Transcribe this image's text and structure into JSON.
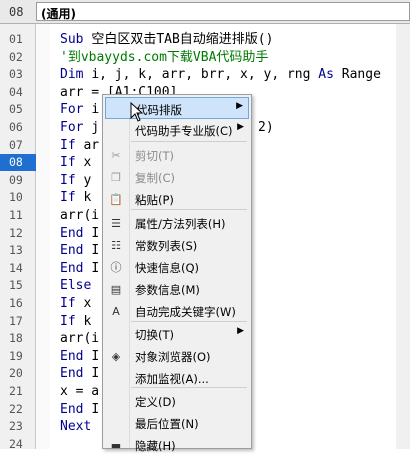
{
  "header": {
    "line_number": "08",
    "object_combo": "(通用)"
  },
  "line_numbers": [
    "01",
    "02",
    "03",
    "04",
    "05",
    "06",
    "07",
    "08",
    "09",
    "10",
    "11",
    "12",
    "13",
    "14",
    "15",
    "16",
    "17",
    "18",
    "19",
    "20",
    "21",
    "22",
    "23",
    "24"
  ],
  "selected_line": "08",
  "code_lines": [
    {
      "kw": "Sub ",
      "rest": "空白区双击TAB自动缩进排版()"
    },
    {
      "cm": "'到vbayyds.com下载VBA代码助手"
    },
    {
      "kw": "Dim ",
      "rest": "i, j, k, arr, brr, x, y, rng ",
      "kw2": "As ",
      "rest2": "Range"
    },
    {
      "rest": "arr = [A1:C100]"
    },
    {
      "kw": "For ",
      "rest": "i"
    },
    {
      "kw": "For ",
      "rest": "j",
      "tail": "2)"
    },
    {
      "kw": "If ",
      "rest": "ar"
    },
    {
      "kw": "If ",
      "rest": "x"
    },
    {
      "kw": "If ",
      "rest": "y"
    },
    {
      "kw": "If ",
      "rest": "k"
    },
    {
      "rest": "arr(i"
    },
    {
      "kw": "End ",
      "rest": "I"
    },
    {
      "kw": "End ",
      "rest": "I"
    },
    {
      "kw": "End ",
      "rest": "I"
    },
    {
      "kw": "Else"
    },
    {
      "kw": "If ",
      "rest": "x"
    },
    {
      "kw": "If ",
      "rest": "k"
    },
    {
      "rest": "arr(i"
    },
    {
      "kw": "End ",
      "rest": "I"
    },
    {
      "kw": "End ",
      "rest": "I"
    },
    {
      "rest": "x = a"
    },
    {
      "kw": "End ",
      "rest": "I"
    },
    {
      "kw": "Next"
    }
  ],
  "context_menu": {
    "items": [
      {
        "label": "代码排版",
        "icon": "none",
        "submenu": true,
        "highlighted": true,
        "disabled": false
      },
      {
        "label": "代码助手专业版(C)",
        "icon": "none",
        "submenu": true,
        "disabled": false
      },
      {
        "label": "剪切(T)",
        "icon": "scissors-icon",
        "disabled": true
      },
      {
        "label": "复制(C)",
        "icon": "copy-icon",
        "disabled": true
      },
      {
        "label": "粘贴(P)",
        "icon": "paste-icon",
        "disabled": false
      },
      {
        "label": "属性/方法列表(H)",
        "icon": "list-icon",
        "disabled": false
      },
      {
        "label": "常数列表(S)",
        "icon": "constant-list-icon",
        "disabled": false
      },
      {
        "label": "快速信息(Q)",
        "icon": "quick-info-icon",
        "disabled": false
      },
      {
        "label": "参数信息(M)",
        "icon": "parameter-info-icon",
        "disabled": false
      },
      {
        "label": "自动完成关键字(W)",
        "icon": "complete-word-icon",
        "disabled": false
      },
      {
        "label": "切换(T)",
        "icon": "none",
        "submenu": true,
        "disabled": false
      },
      {
        "label": "对象浏览器(O)",
        "icon": "object-browser-icon",
        "disabled": false
      },
      {
        "label": "添加监视(A)...",
        "icon": "none",
        "disabled": false
      },
      {
        "label": "定义(D)",
        "icon": "none",
        "disabled": false
      },
      {
        "label": "最后位置(N)",
        "icon": "none",
        "disabled": false
      },
      {
        "label": "隐藏(H)",
        "icon": "hide-icon",
        "disabled": false
      }
    ]
  },
  "colors": {
    "keyword": "#00008b",
    "comment": "#007a00",
    "selection": "#1e6fd0",
    "menu_highlight": "#cfe4fa"
  }
}
